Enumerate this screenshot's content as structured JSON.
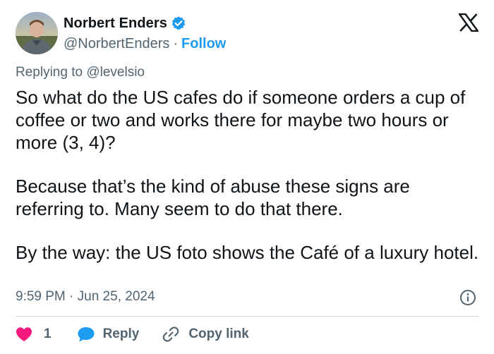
{
  "author": {
    "display_name": "Norbert Enders",
    "handle": "@NorbertEnders",
    "separator": "·",
    "follow_label": "Follow"
  },
  "reply_context": {
    "prefix": "Replying to ",
    "mention": "@levelsio"
  },
  "tweet": {
    "paragraphs": [
      "So what do the US cafes do if someone orders a cup of coffee or two and works there for maybe two hours or more (3, 4)?",
      "Because that’s the kind of abuse these signs are referring to. Many seem to do that there.",
      "By the way: the US foto shows the Café of a luxury hotel."
    ],
    "timestamp": "9:59 PM · Jun 25, 2024"
  },
  "actions": {
    "like_count": "1",
    "reply_label": "Reply",
    "copy_link_label": "Copy link"
  },
  "colors": {
    "accent": "#1d9bf0",
    "like": "#f91880",
    "text": "#0f1419",
    "muted": "#536471"
  },
  "icons": {
    "verified": "verified-badge-icon",
    "logo": "x-logo-icon",
    "info": "info-icon",
    "like": "heart-icon",
    "reply": "speech-bubble-icon",
    "copy": "link-icon"
  }
}
